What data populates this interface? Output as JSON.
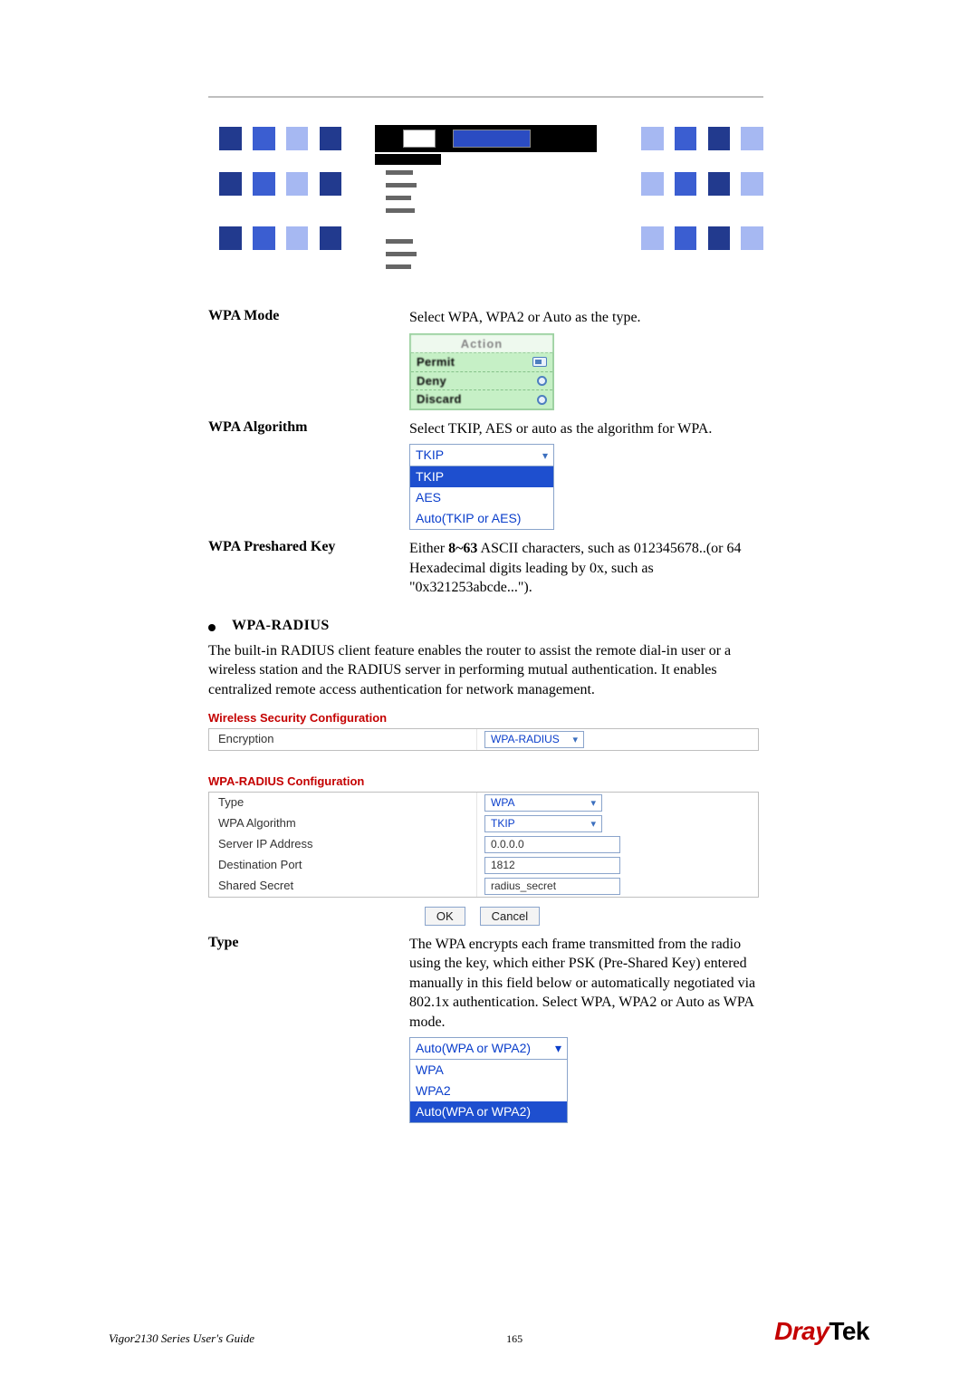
{
  "defs": {
    "wpa_mode": {
      "label": "WPA Mode",
      "desc": "Select WPA, WPA2 or Auto as the type.",
      "action": {
        "title": "Action",
        "options": [
          "Permit",
          "Deny",
          "Discard"
        ]
      }
    },
    "wpa_algo": {
      "label": "WPA Algorithm",
      "desc": "Select TKIP, AES or auto as the algorithm for WPA.",
      "dropdown": {
        "selected": "TKIP",
        "options": [
          "TKIP",
          "AES",
          "Auto(TKIP or AES)"
        ]
      }
    },
    "wpa_psk": {
      "label": "WPA Preshared Key",
      "desc_prefix": "Either ",
      "desc_bold": "8~63",
      "desc_suffix": " ASCII characters, such as 012345678..(or 64 Hexadecimal digits leading by 0x, such as \"0x321253abcde...\")."
    }
  },
  "section": {
    "title": "WPA-RADIUS",
    "para": "The built-in RADIUS client feature enables the router to assist the remote dial-in user or a wireless station and the RADIUS server in performing mutual authentication. It enables centralized remote access authentication for network management."
  },
  "shot1": {
    "title": "Wireless Security Configuration",
    "label": "Encryption",
    "value": "WPA-RADIUS"
  },
  "shot2": {
    "title": "WPA-RADIUS Configuration",
    "rows": [
      {
        "label": "Type",
        "kind": "select",
        "value": "WPA"
      },
      {
        "label": "WPA Algorithm",
        "kind": "select",
        "value": "TKIP"
      },
      {
        "label": "Server IP Address",
        "kind": "input",
        "value": "0.0.0.0"
      },
      {
        "label": "Destination Port",
        "kind": "input",
        "value": "1812"
      },
      {
        "label": "Shared Secret",
        "kind": "input",
        "value": "radius_secret"
      }
    ],
    "buttons": {
      "ok": "OK",
      "cancel": "Cancel"
    }
  },
  "type_def": {
    "label": "Type",
    "desc": "The WPA encrypts each frame transmitted from the radio using the key, which either PSK (Pre-Shared Key) entered manually in this field below or automatically negotiated via 802.1x authentication. Select WPA, WPA2 or Auto as WPA mode.",
    "dropdown": {
      "selected": "Auto(WPA or WPA2)",
      "options": [
        "WPA",
        "WPA2",
        "Auto(WPA or WPA2)"
      ]
    }
  },
  "footer": {
    "book": "Vigor2130 Series User's Guide",
    "page": "165",
    "brand_italic": "Dray",
    "brand_rest": "Tek"
  }
}
